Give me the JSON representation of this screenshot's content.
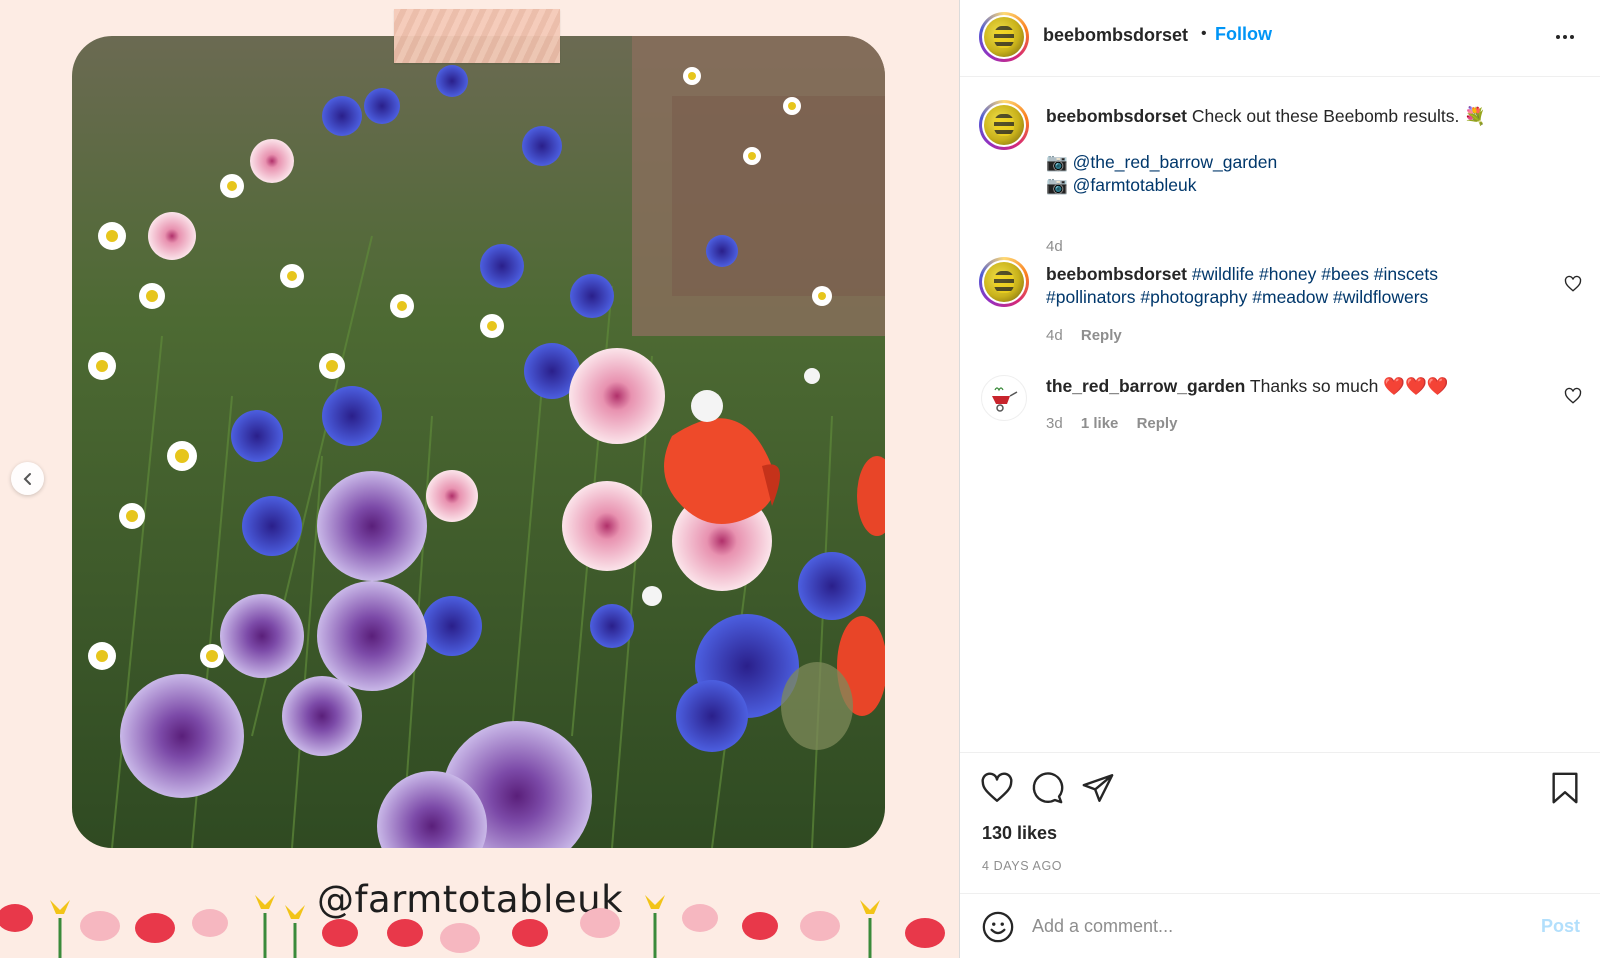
{
  "post": {
    "username": "beebombsdorset",
    "follow_label": "Follow",
    "separator": "•",
    "media_caption": "@farmtotableuk"
  },
  "comments": [
    {
      "username": "beebombsdorset",
      "text": "Check out these Beebomb results. 💐",
      "camera_1": "📷",
      "mention_1": "@the_red_barrow_garden",
      "camera_2": "📷",
      "mention_2": "@farmtotableuk",
      "time": "4d"
    },
    {
      "username": "beebombsdorset",
      "hashtags_line_1": "#wildlife #honey #bees #inscets",
      "hashtags_line_2": "#pollinators #photography #meadow #wildflowers",
      "time": "4d",
      "reply_label": "Reply"
    },
    {
      "username": "the_red_barrow_garden",
      "text": "Thanks so much ❤️❤️❤️",
      "time": "3d",
      "likes_label": "1 like",
      "reply_label": "Reply"
    }
  ],
  "footer": {
    "likes": "130 likes",
    "time_ago": "4 DAYS AGO",
    "comment_placeholder": "Add a comment...",
    "post_label": "Post"
  },
  "icons": {
    "like": "heart-icon",
    "comment": "comment-bubble-icon",
    "share": "paper-plane-icon",
    "save": "bookmark-icon",
    "more": "more-options-icon",
    "emoji": "emoji-icon",
    "carousel_prev": "chevron-left-icon"
  },
  "colors": {
    "follow_blue": "#0095f6",
    "link_navy": "#00376b",
    "post_disabled": "#b2dffc",
    "media_background": "#fdece4"
  }
}
